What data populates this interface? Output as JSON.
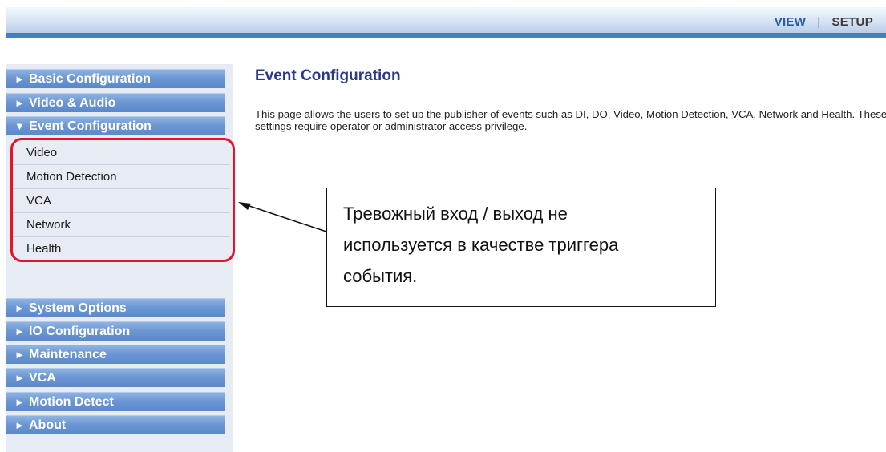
{
  "topnav": {
    "view_label": "VIEW",
    "separator": "|",
    "setup_label": "SETUP"
  },
  "sidebar": {
    "top_items": [
      {
        "arrow": "►",
        "label": "Basic Configuration"
      },
      {
        "arrow": "►",
        "label": "Video & Audio"
      },
      {
        "arrow": "▼",
        "label": "Event Configuration"
      }
    ],
    "submenu": [
      "Video",
      "Motion Detection",
      "VCA",
      "Network",
      "Health"
    ],
    "bottom_items": [
      {
        "arrow": "►",
        "label": "System Options"
      },
      {
        "arrow": "►",
        "label": "IO Configuration"
      },
      {
        "arrow": "►",
        "label": "Maintenance"
      },
      {
        "arrow": "►",
        "label": "VCA"
      },
      {
        "arrow": "►",
        "label": "Motion Detect"
      },
      {
        "arrow": "►",
        "label": "About"
      }
    ]
  },
  "main": {
    "title": "Event Configuration",
    "description": "This page allows the users to set up the publisher of events such as DI, DO, Video, Motion Detection, VCA, Network and Health. These settings require operator or administrator access privilege."
  },
  "annotation": {
    "callout_lines": [
      "Тревожный вход / выход не",
      "используется в качестве триггера",
      "события."
    ],
    "highlight_color": "#e4142b"
  }
}
